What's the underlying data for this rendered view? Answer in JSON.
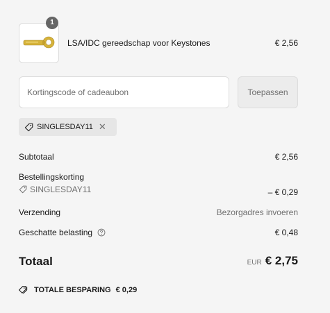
{
  "cart": {
    "items": [
      {
        "name": "LSA/IDC gereedschap voor Keystones",
        "price": "€ 2,56",
        "quantity": "1",
        "image_icon": "punch-down-tool-icon"
      }
    ]
  },
  "discount": {
    "placeholder": "Kortingscode of cadeaubon",
    "value": "",
    "apply_label": "Toepassen",
    "applied_code": "SINGLESDAY11",
    "remove_icon": "close-icon"
  },
  "summary": {
    "subtotal_label": "Subtotaal",
    "subtotal_value": "€ 2,56",
    "order_discount_label": "Bestellingskorting",
    "order_discount_code": "SINGLESDAY11",
    "order_discount_value": "– € 0,29",
    "shipping_label": "Verzending",
    "shipping_value": "Bezorgadres invoeren",
    "tax_label": "Geschatte belasting",
    "tax_value": "€ 0,48",
    "total_label": "Totaal",
    "total_currency": "EUR",
    "total_value": "€ 2,75",
    "savings_label": "TOTALE BESPARING",
    "savings_value": "€ 0,29"
  },
  "colors": {
    "background": "#f5f5f5",
    "muted_text": "#707070",
    "badge": "#666666",
    "tool_yellow": "#d6b33a"
  }
}
